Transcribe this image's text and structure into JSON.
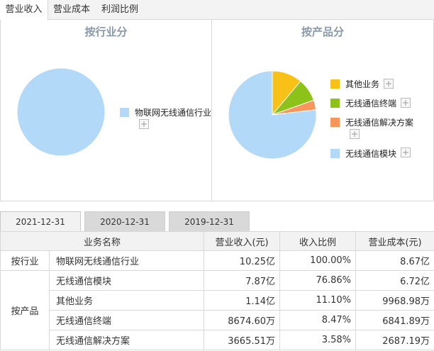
{
  "top_tabs": [
    "营业收入",
    "营业成本",
    "利润比例"
  ],
  "panels": {
    "left": {
      "title": "按行业分",
      "legend": [
        {
          "label": "物联网无线通信行业",
          "color": "#b3d9f8"
        }
      ]
    },
    "right": {
      "title": "按产品分",
      "legend": [
        {
          "label": "其他业务",
          "color": "#f7c118"
        },
        {
          "label": "无线通信终端",
          "color": "#8cc21a"
        },
        {
          "label": "无线通信解决方案",
          "color": "#f7965a"
        },
        {
          "label": "无线通信模块",
          "color": "#b3d9f8"
        }
      ]
    },
    "plus_symbol": "+"
  },
  "chart_data": [
    {
      "type": "pie",
      "title": "按行业分",
      "labels": [
        "物联网无线通信行业"
      ],
      "values": [
        100.0
      ],
      "colors": [
        "#b3d9f8"
      ],
      "legend": "right"
    },
    {
      "type": "pie",
      "title": "按产品分",
      "labels": [
        "其他业务",
        "无线通信终端",
        "无线通信解决方案",
        "无线通信模块"
      ],
      "values": [
        11.1,
        8.47,
        3.58,
        76.86
      ],
      "colors": [
        "#f7c118",
        "#8cc21a",
        "#f7965a",
        "#b3d9f8"
      ],
      "legend": "right"
    }
  ],
  "period_tabs": [
    "2021-12-31",
    "2020-12-31",
    "2019-12-31"
  ],
  "table": {
    "headers": [
      "业务名称",
      "营业收入(元)",
      "收入比例",
      "营业成本(元)"
    ],
    "groups": [
      {
        "label": "按行业",
        "rows": [
          {
            "name": "物联网无线通信行业",
            "revenue": "10.25亿",
            "ratio": "100.00%",
            "cost": "8.67亿"
          }
        ]
      },
      {
        "label": "按产品",
        "rows": [
          {
            "name": "无线通信模块",
            "revenue": "7.87亿",
            "ratio": "76.86%",
            "cost": "6.72亿"
          },
          {
            "name": "其他业务",
            "revenue": "1.14亿",
            "ratio": "11.10%",
            "cost": "9968.98万"
          },
          {
            "name": "无线通信终端",
            "revenue": "8674.60万",
            "ratio": "8.47%",
            "cost": "6841.89万"
          },
          {
            "name": "无线通信解决方案",
            "revenue": "3665.51万",
            "ratio": "3.58%",
            "cost": "2687.19万"
          }
        ]
      }
    ]
  }
}
